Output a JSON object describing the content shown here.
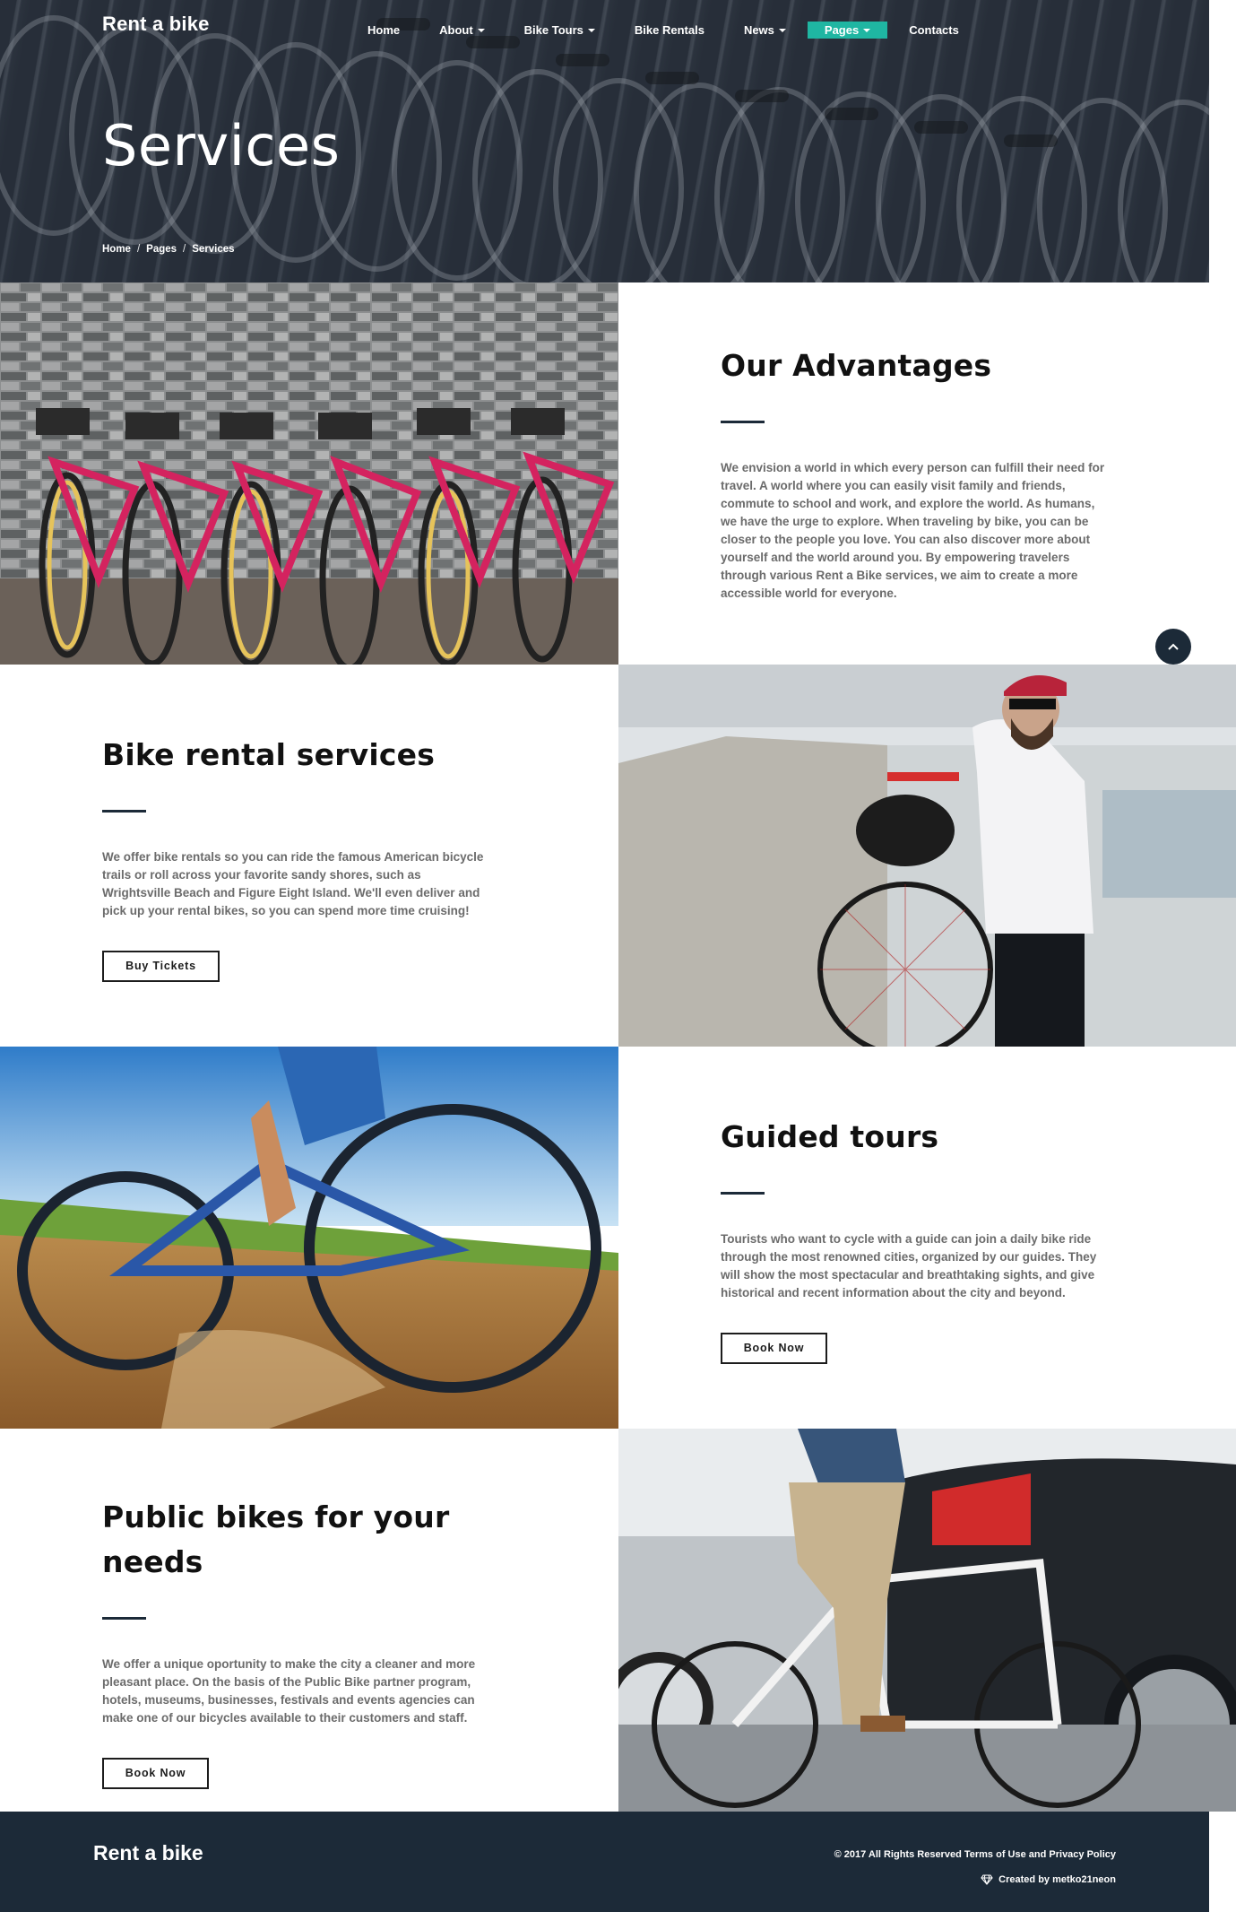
{
  "header": {
    "brand": "Rent a bike",
    "nav": [
      {
        "label": "Home",
        "dropdown": false,
        "active": false
      },
      {
        "label": "About",
        "dropdown": true,
        "active": false
      },
      {
        "label": "Bike Tours",
        "dropdown": true,
        "active": false
      },
      {
        "label": "Bike Rentals",
        "dropdown": false,
        "active": false
      },
      {
        "label": "News",
        "dropdown": true,
        "active": false
      },
      {
        "label": "Pages",
        "dropdown": true,
        "active": true
      },
      {
        "label": "Contacts",
        "dropdown": false,
        "active": false
      }
    ],
    "page_title": "Services",
    "breadcrumb": [
      "Home",
      "Pages",
      "Services"
    ],
    "breadcrumb_separator": "/"
  },
  "sections": {
    "advantages": {
      "title": "Our Advantages",
      "text": "We envision a world in which every person can fulfill their need for travel. A world where you can easily visit family and friends, commute to school and work, and explore the world. As humans, we have the urge to explore. When traveling by bike, you can be closer to the people you love. You can also discover more about yourself and the world around you. By empowering travelers through various Rent a Bike services, we aim to create a more accessible world for everyone."
    },
    "rental": {
      "title": "Bike rental services",
      "text": "We offer bike rentals so you can ride the famous American bicycle trails or roll across your favorite sandy shores, such as Wrightsville Beach and Figure Eight Island. We'll even deliver and pick up your rental bikes, so you can spend more time cruising!",
      "button": "Buy Tickets"
    },
    "tours": {
      "title": "Guided tours",
      "text": "Tourists who want to cycle with a guide can join a daily bike ride through the most renowned cities, organized by our guides. They will show the most spectacular and breathtaking sights, and give historical and recent information about the city and beyond.",
      "button": "Book Now"
    },
    "public": {
      "title_line1": "Public bikes for your",
      "title_line2": "needs",
      "text": "We offer a unique oportunity to make the city a cleaner and more pleasant place. On the basis of the Public Bike partner program, hotels, museums, businesses, festivals and events agencies can make one of our bicycles available to their customers and staff.",
      "button": "Book Now"
    }
  },
  "scroll_top_icon": "chevron-up-icon",
  "footer": {
    "brand": "Rent a bike",
    "copyright": "© 2017 All Rights Reserved Terms of Use and Privacy Policy",
    "credit": "Created by metko21neon",
    "credit_icon": "diamond-icon"
  },
  "colors": {
    "accent": "#1fb6a2",
    "dark": "#1c2a38",
    "text_gray": "#6b6b6b"
  }
}
